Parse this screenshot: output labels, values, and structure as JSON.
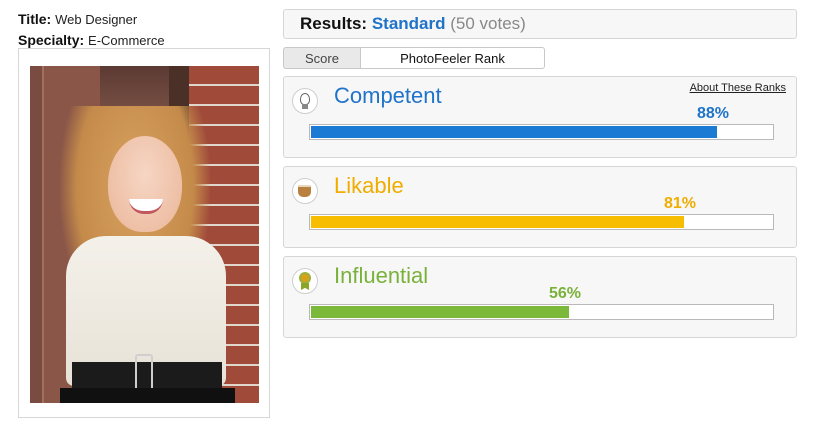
{
  "profile": {
    "title_label": "Title:",
    "title_value": "Web Designer",
    "specialty_label": "Specialty:",
    "specialty_value": "E-Commerce"
  },
  "results": {
    "label": "Results:",
    "category": "Standard",
    "votes": "(50 votes)"
  },
  "tabs": {
    "score": "Score",
    "rank": "PhotoFeeler Rank",
    "active": "rank"
  },
  "about_link": "About These Ranks",
  "ranks": [
    {
      "name": "Competent",
      "percent_label": "88%",
      "value": 0.88,
      "color": "#1f73c9",
      "bar_color": "#1b7ad4",
      "icon": "lightbulb-icon"
    },
    {
      "name": "Likable",
      "percent_label": "81%",
      "value": 0.81,
      "color": "#f0ad00",
      "bar_color": "#f7bd00",
      "icon": "coffee-cup-icon"
    },
    {
      "name": "Influential",
      "percent_label": "56%",
      "value": 0.56,
      "color": "#7ab13a",
      "bar_color": "#7cb83a",
      "icon": "ribbon-award-icon"
    }
  ]
}
